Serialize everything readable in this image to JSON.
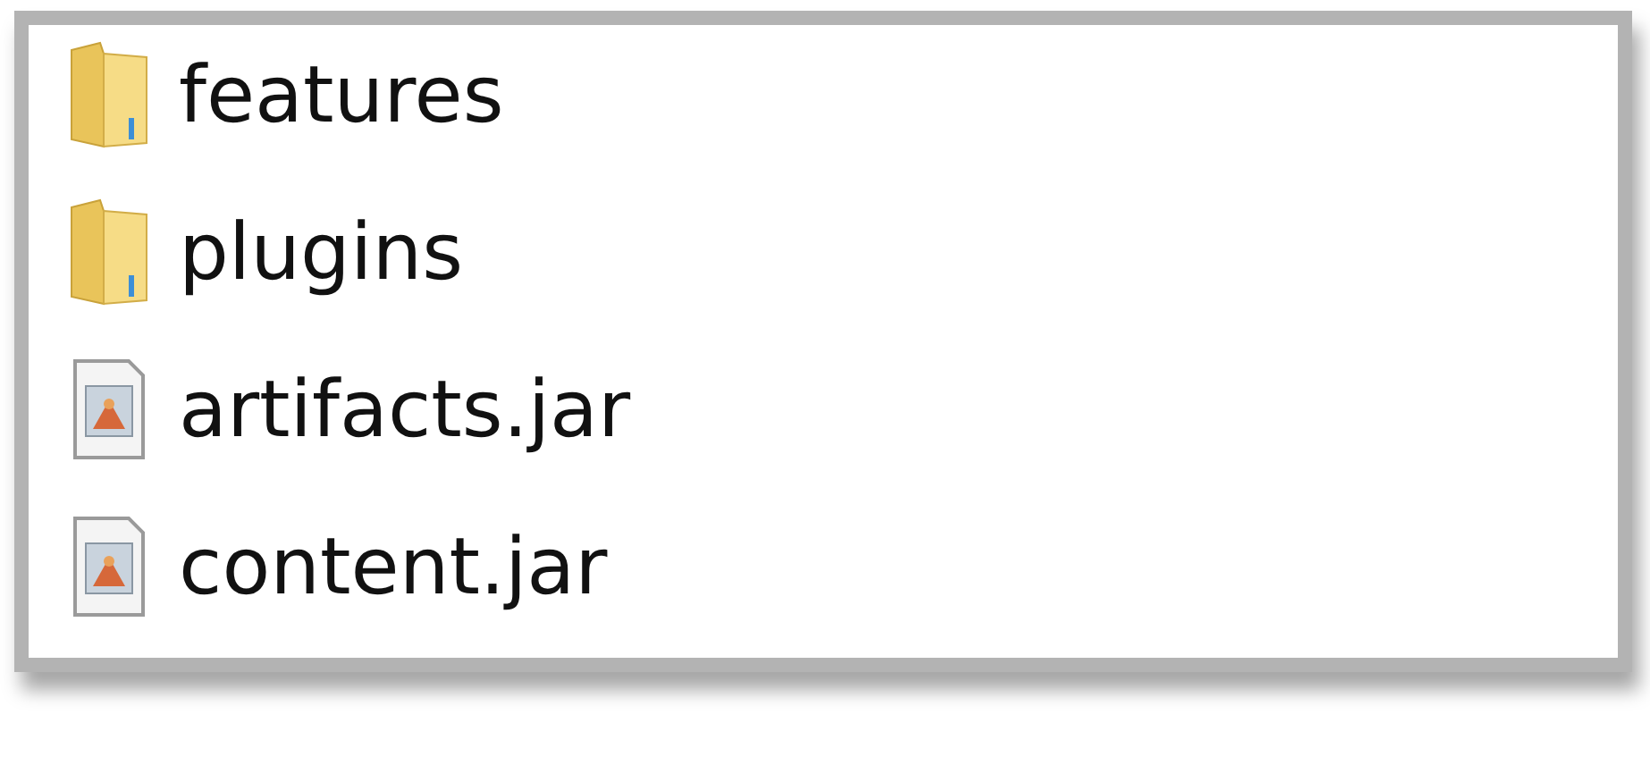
{
  "files": [
    {
      "name": "features",
      "kind": "folder"
    },
    {
      "name": "plugins",
      "kind": "folder"
    },
    {
      "name": "artifacts.jar",
      "kind": "file"
    },
    {
      "name": "content.jar",
      "kind": "file"
    }
  ]
}
